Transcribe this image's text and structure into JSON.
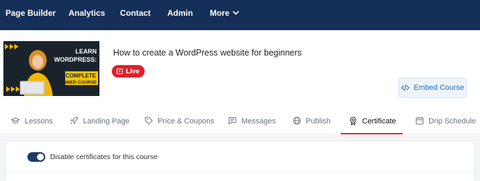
{
  "nav": {
    "items": [
      "Page Builder",
      "Analytics",
      "Contact",
      "Admin"
    ],
    "more_label": "More"
  },
  "course": {
    "title": "How to create a WordPress website for beginners",
    "status_badge": "Live",
    "thumbnail_text": {
      "line1": "LEARN",
      "line2": "WORDPRESS:",
      "line3": "A COMPLETE",
      "line4": "BEGINNER COURSE"
    },
    "embed_label": "Embed Course"
  },
  "tabs": [
    {
      "label": "Lessons",
      "icon": "graduation-cap-icon"
    },
    {
      "label": "Landing Page",
      "icon": "rocket-icon"
    },
    {
      "label": "Price & Coupons",
      "icon": "tag-icon"
    },
    {
      "label": "Messages",
      "icon": "message-icon"
    },
    {
      "label": "Publish",
      "icon": "globe-icon"
    },
    {
      "label": "Certificate",
      "icon": "certificate-icon",
      "active": true
    },
    {
      "label": "Drip Schedule",
      "icon": "calendar-icon"
    }
  ],
  "certificate_settings": {
    "disable_toggle_label": "Disable certificates for this course",
    "disable_toggle_on": true
  },
  "colors": {
    "nav_bg": "#142f58",
    "live_red": "#e0202c",
    "active_tab_underline": "#d9262c",
    "toggle_on": "#1f3a66",
    "embed_text": "#2f6db3"
  }
}
